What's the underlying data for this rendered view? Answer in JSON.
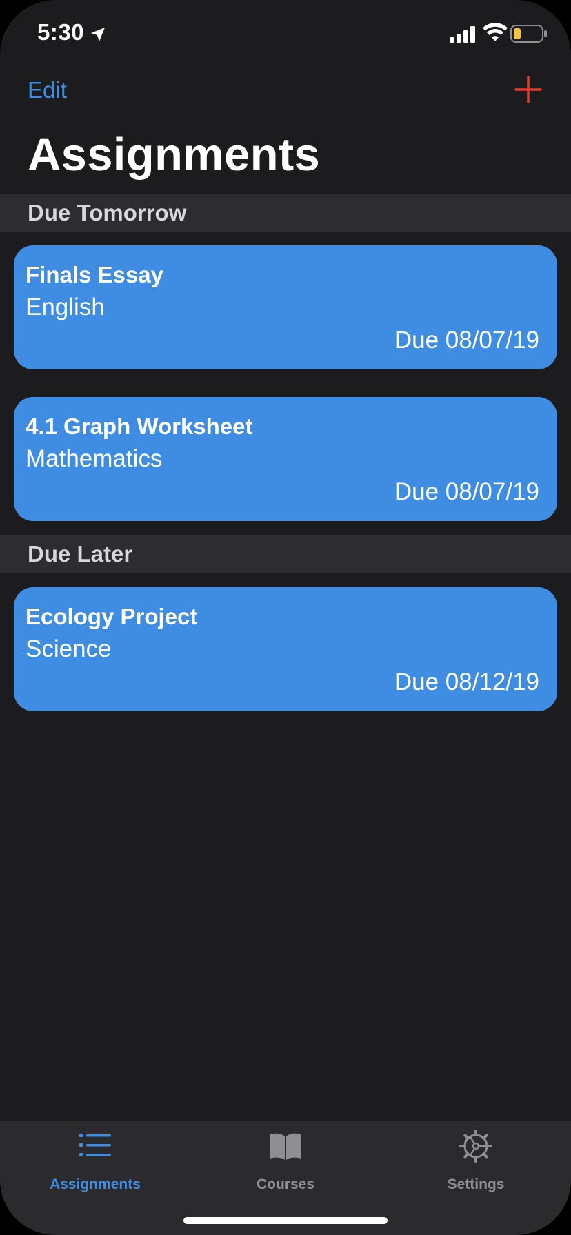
{
  "status_bar": {
    "time": "5:30"
  },
  "nav": {
    "edit_label": "Edit",
    "add_icon": "plus-icon",
    "title": "Assignments"
  },
  "sections": [
    {
      "header": "Due Tomorrow",
      "cards": [
        {
          "title": "Finals Essay",
          "course": "English",
          "due": "Due 08/07/19"
        },
        {
          "title": "4.1 Graph Worksheet",
          "course": "Mathematics",
          "due": "Due 08/07/19"
        }
      ]
    },
    {
      "header": "Due Later",
      "cards": [
        {
          "title": "Ecology Project",
          "course": "Science",
          "due": "Due 08/12/19"
        }
      ]
    }
  ],
  "tab_bar": {
    "tabs": [
      {
        "label": "Assignments",
        "icon": "list-icon",
        "active": true
      },
      {
        "label": "Courses",
        "icon": "book-icon",
        "active": false
      },
      {
        "label": "Settings",
        "icon": "gear-icon",
        "active": false
      }
    ]
  },
  "colors": {
    "accent": "#3f8de3",
    "add_button": "#e5392f",
    "background": "#1c1c1e",
    "section_header_bg": "#2d2d2f",
    "tab_inactive": "#8e8e93",
    "battery_level": "#f5c542"
  }
}
